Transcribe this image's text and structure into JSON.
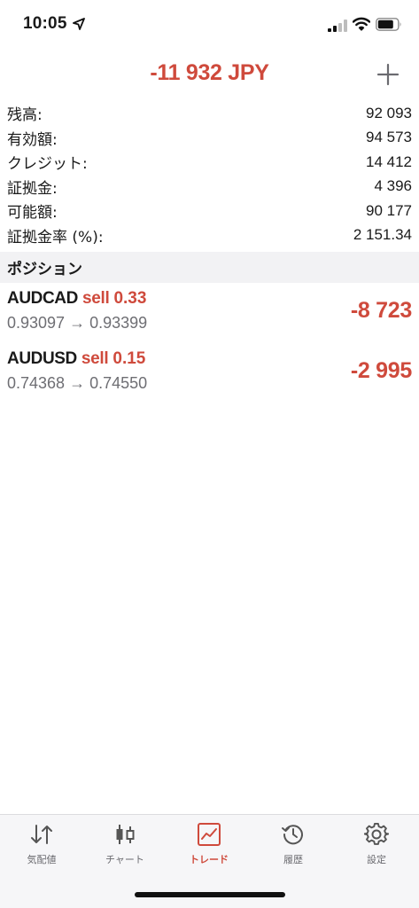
{
  "status_bar": {
    "time": "10:05"
  },
  "header": {
    "title": "-11 932 JPY"
  },
  "summary": [
    {
      "label": "残高:",
      "value": "92 093"
    },
    {
      "label": "有効額:",
      "value": "94 573"
    },
    {
      "label": "クレジット:",
      "value": "14 412"
    },
    {
      "label": "証拠金:",
      "value": "4 396"
    },
    {
      "label": "可能額:",
      "value": "90 177"
    },
    {
      "label": "証拠金率 (%):",
      "value": "2 151.34"
    }
  ],
  "positions_section": {
    "title": "ポジション"
  },
  "positions": [
    {
      "symbol": "AUDCAD",
      "type": "sell",
      "volume": "0.33",
      "open_price": "0.93097",
      "arrow": "→",
      "current_price": "0.93399",
      "profit": "-8 723"
    },
    {
      "symbol": "AUDUSD",
      "type": "sell",
      "volume": "0.15",
      "open_price": "0.74368",
      "arrow": "→",
      "current_price": "0.74550",
      "profit": "-2 995"
    }
  ],
  "tabs": [
    {
      "label": "気配値",
      "icon": "quotes-arrows-icon"
    },
    {
      "label": "チャート",
      "icon": "candlestick-icon"
    },
    {
      "label": "トレード",
      "icon": "trade-chart-icon",
      "active": true
    },
    {
      "label": "履歴",
      "icon": "history-clock-icon"
    },
    {
      "label": "設定",
      "icon": "gear-icon"
    }
  ],
  "colors": {
    "accent": "#cf4a3c",
    "text": "#1a1a1a",
    "secondary_text": "#6e6e73",
    "section_bg": "#f2f2f4",
    "tab_bar_bg": "#f6f6f8"
  }
}
